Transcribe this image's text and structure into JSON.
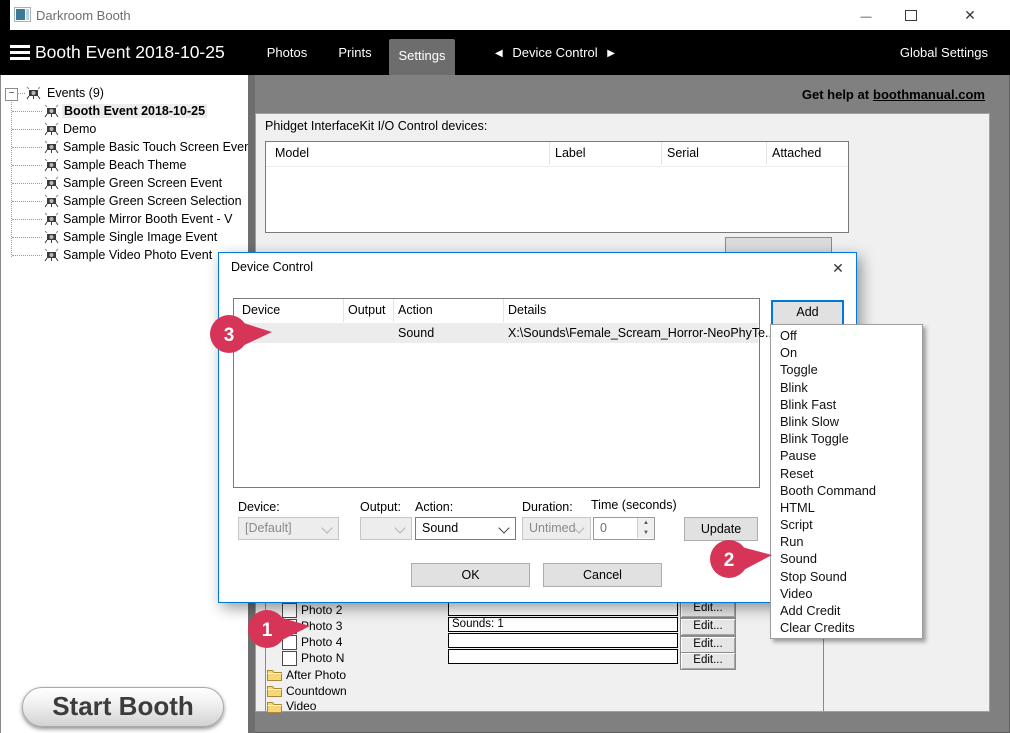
{
  "titlebar": {
    "title": "Darkroom Booth",
    "minimize_glyph": "—",
    "close_glyph": "✕"
  },
  "nav": {
    "event_title": "Booth Event 2018-10-25",
    "tabs": [
      "Photos",
      "Prints",
      "Settings"
    ],
    "active_tab": "Settings",
    "pager_left": "◀",
    "pager_label": "Device Control",
    "pager_right": "▶",
    "global_settings": "Global Settings"
  },
  "sidebar": {
    "expander_glyph": "−",
    "root_label": "Events (9)",
    "items": [
      "Booth Event 2018-10-25",
      "Demo",
      "Sample Basic Touch Screen Event",
      "Sample Beach Theme",
      "Sample Green Screen Event",
      "Sample Green Screen Selection",
      "Sample Mirror Booth Event - V",
      "Sample Single Image Event",
      "Sample Video Photo Event"
    ],
    "selected_item": "Booth Event 2018-10-25",
    "start_button": "Start Booth"
  },
  "main": {
    "help_prefix": "Get help at",
    "help_link": "boothmanual.com",
    "phidget_label": "Phidget InterfaceKit I/O Control devices:",
    "phidget_columns": [
      "Model",
      "Label",
      "Serial",
      "Attached"
    ]
  },
  "dialog": {
    "title": "Device Control",
    "close_glyph": "✕",
    "columns": [
      "Device",
      "Output",
      "Action",
      "Details"
    ],
    "row": {
      "device": "",
      "output": "",
      "action": "Sound",
      "details": "X:\\Sounds\\Female_Scream_Horror-NeoPhyTe..."
    },
    "add_button": "Add",
    "device_label": "Device:",
    "device_value": "[Default]",
    "output_label": "Output:",
    "output_value": "",
    "action_label": "Action:",
    "action_value": "Sound",
    "duration_label": "Duration:",
    "duration_value": "Untimed",
    "time_label": "Time (seconds)",
    "time_value": "0",
    "spin_up": "▲",
    "spin_down": "▼",
    "update_button": "Update",
    "ok_button": "OK",
    "cancel_button": "Cancel"
  },
  "menu": {
    "items": [
      "Off",
      "On",
      "Toggle",
      "Blink",
      "Blink Fast",
      "Blink Slow",
      "Blink Toggle",
      "Pause",
      "Reset",
      "Booth Command",
      "HTML",
      "Script",
      "Run",
      "Sound",
      "Stop Sound",
      "Video",
      "Add Credit",
      "Clear Credits"
    ],
    "pointed_item": "Sound"
  },
  "background": {
    "check_glyph": "✓",
    "rows": [
      {
        "label": "Photo 2",
        "checked": false,
        "value": "",
        "edit": "Edit..."
      },
      {
        "label": "Photo 3",
        "checked": true,
        "value": "Sounds: 1",
        "edit": "Edit..."
      },
      {
        "label": "Photo 4",
        "checked": false,
        "value": "",
        "edit": "Edit..."
      },
      {
        "label": "Photo N",
        "checked": false,
        "value": "",
        "edit": "Edit..."
      }
    ],
    "folders": [
      "After Photo",
      "Countdown",
      "Video"
    ]
  },
  "callouts": [
    {
      "number": "1"
    },
    {
      "number": "2"
    },
    {
      "number": "3"
    }
  ],
  "colors": {
    "accent_blue": "#0078d7",
    "callout_red": "#d63558",
    "nav_black": "#000000",
    "active_tab_gray": "#6d6d6d",
    "panel_gray": "#f0f0f0",
    "frame_gray": "#808080",
    "check_green": "#2faa28",
    "folder_yellow": "#f7d67a"
  }
}
